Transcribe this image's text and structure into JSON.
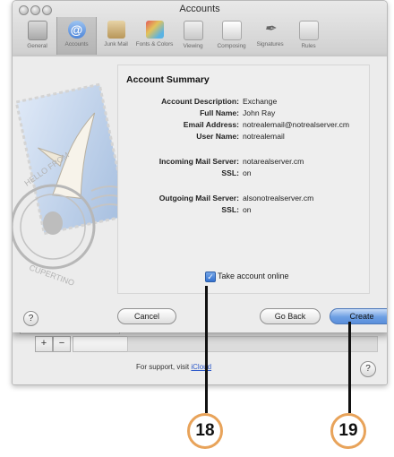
{
  "window": {
    "title": "Accounts"
  },
  "toolbar": [
    {
      "label": "General",
      "icon": "general-icon",
      "selected": false
    },
    {
      "label": "Accounts",
      "icon": "at-icon",
      "selected": true
    },
    {
      "label": "Junk Mail",
      "icon": "junk-mail-icon",
      "selected": false
    },
    {
      "label": "Fonts & Colors",
      "icon": "fonts-colors-icon",
      "selected": false
    },
    {
      "label": "Viewing",
      "icon": "viewing-icon",
      "selected": false
    },
    {
      "label": "Composing",
      "icon": "composing-icon",
      "selected": false
    },
    {
      "label": "Signatures",
      "icon": "signatures-icon",
      "selected": false
    },
    {
      "label": "Rules",
      "icon": "rules-icon",
      "selected": false
    }
  ],
  "summary": {
    "heading": "Account Summary",
    "rows": [
      {
        "key": "Account Description:",
        "value": "Exchange"
      },
      {
        "key": "Full Name:",
        "value": "John Ray"
      },
      {
        "key": "Email Address:",
        "value": "notrealemail@notrealserver.cm"
      },
      {
        "key": "User Name:",
        "value": "notrealemail"
      },
      {
        "key": "Incoming Mail Server:",
        "value": "notarealserver.cm"
      },
      {
        "key": "SSL:",
        "value": "on"
      },
      {
        "key": "Outgoing Mail Server:",
        "value": "alsonotrealserver.cm"
      },
      {
        "key": "SSL:",
        "value": "on"
      }
    ],
    "checkbox_label": "Take account online",
    "checkbox_checked": true
  },
  "buttons": {
    "help": "?",
    "cancel": "Cancel",
    "go_back": "Go Back",
    "create": "Create"
  },
  "stamp_text": "HELLO FROM CUPERTINO",
  "list_controls": {
    "add": "+",
    "remove": "−"
  },
  "support": {
    "text": "For support, visit",
    "link": "iCloud"
  },
  "callouts": [
    "18",
    "19"
  ],
  "colors": {
    "accent": "#5a8fdb",
    "callout_ring": "#e8a35a"
  }
}
